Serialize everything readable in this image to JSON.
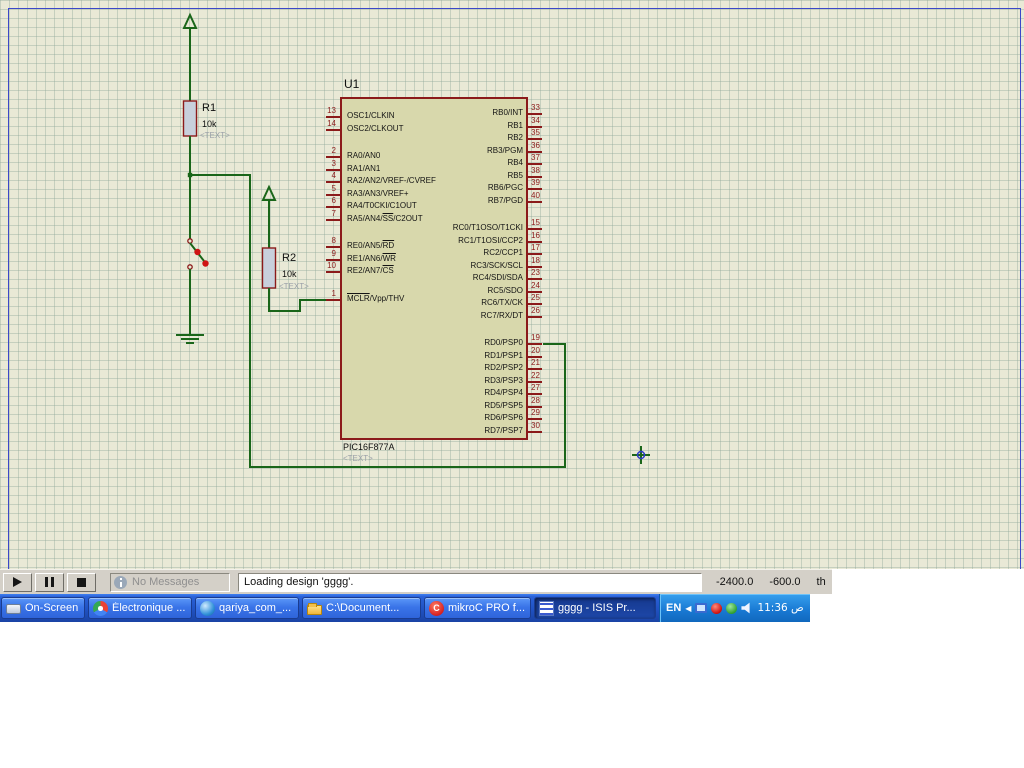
{
  "schematic": {
    "sheet": {
      "background": "#e9e9d6",
      "grid_color": "#cdd5bd",
      "border_color": "#3b48c9"
    },
    "wire_color": "#1a661a",
    "switch_dot_color": "#cf1414",
    "components": {
      "r1": {
        "ref": "R1",
        "value": "10k",
        "text": "<TEXT>"
      },
      "r2": {
        "ref": "R2",
        "value": "10k",
        "text": "<TEXT>"
      },
      "u1": {
        "ref": "U1",
        "device": "PIC16F877A",
        "text": "<TEXT>",
        "body_fill": "#d8d8ac",
        "outline": "#8b1a1a",
        "left_pins": [
          {
            "num": "13",
            "parts": [
              {
                "t": "OSC1/CLKIN",
                "o": false
              }
            ]
          },
          {
            "num": "14",
            "parts": [
              {
                "t": "OSC2/CLKOUT",
                "o": false
              }
            ]
          },
          {
            "num": "2",
            "gap": true,
            "parts": [
              {
                "t": "RA0/AN0",
                "o": false
              }
            ]
          },
          {
            "num": "3",
            "parts": [
              {
                "t": "RA1/AN1",
                "o": false
              }
            ]
          },
          {
            "num": "4",
            "parts": [
              {
                "t": "RA2/AN2/VREF-/CVREF",
                "o": false
              }
            ]
          },
          {
            "num": "5",
            "parts": [
              {
                "t": "RA3/AN3/VREF+",
                "o": false
              }
            ]
          },
          {
            "num": "6",
            "parts": [
              {
                "t": "RA4/T0CKI/C1OUT",
                "o": false
              }
            ]
          },
          {
            "num": "7",
            "parts": [
              {
                "t": "RA5/AN4/",
                "o": false
              },
              {
                "t": "SS",
                "o": true
              },
              {
                "t": "/C2OUT",
                "o": false
              }
            ]
          },
          {
            "num": "8",
            "gap": true,
            "parts": [
              {
                "t": "RE0/AN5/",
                "o": false
              },
              {
                "t": "RD",
                "o": true
              }
            ]
          },
          {
            "num": "9",
            "parts": [
              {
                "t": "RE1/AN6/",
                "o": false
              },
              {
                "t": "WR",
                "o": true
              }
            ]
          },
          {
            "num": "10",
            "parts": [
              {
                "t": "RE2/AN7/",
                "o": false
              },
              {
                "t": "CS",
                "o": true
              }
            ]
          },
          {
            "num": "1",
            "gap": true,
            "parts": [
              {
                "t": "MCLR",
                "o": true
              },
              {
                "t": "/Vpp/THV",
                "o": false
              }
            ]
          }
        ],
        "right_pins": [
          {
            "num": "33",
            "parts": [
              {
                "t": "RB0/INT",
                "o": false
              }
            ]
          },
          {
            "num": "34",
            "parts": [
              {
                "t": "RB1",
                "o": false
              }
            ]
          },
          {
            "num": "35",
            "parts": [
              {
                "t": "RB2",
                "o": false
              }
            ]
          },
          {
            "num": "36",
            "parts": [
              {
                "t": "RB3/PGM",
                "o": false
              }
            ]
          },
          {
            "num": "37",
            "parts": [
              {
                "t": "RB4",
                "o": false
              }
            ]
          },
          {
            "num": "38",
            "parts": [
              {
                "t": "RB5",
                "o": false
              }
            ]
          },
          {
            "num": "39",
            "parts": [
              {
                "t": "RB6/PGC",
                "o": false
              }
            ]
          },
          {
            "num": "40",
            "parts": [
              {
                "t": "RB7/PGD",
                "o": false
              }
            ]
          },
          {
            "num": "15",
            "gap": true,
            "parts": [
              {
                "t": "RC0/T1OSO/T1CKI",
                "o": false
              }
            ]
          },
          {
            "num": "16",
            "parts": [
              {
                "t": "RC1/T1OSI/CCP2",
                "o": false
              }
            ]
          },
          {
            "num": "17",
            "parts": [
              {
                "t": "RC2/CCP1",
                "o": false
              }
            ]
          },
          {
            "num": "18",
            "parts": [
              {
                "t": "RC3/SCK/SCL",
                "o": false
              }
            ]
          },
          {
            "num": "23",
            "parts": [
              {
                "t": "RC4/SDI/SDA",
                "o": false
              }
            ]
          },
          {
            "num": "24",
            "parts": [
              {
                "t": "RC5/SDO",
                "o": false
              }
            ]
          },
          {
            "num": "25",
            "parts": [
              {
                "t": "RC6/TX/CK",
                "o": false
              }
            ]
          },
          {
            "num": "26",
            "parts": [
              {
                "t": "RC7/RX/DT",
                "o": false
              }
            ]
          },
          {
            "num": "19",
            "gap": true,
            "parts": [
              {
                "t": "RD0/PSP0",
                "o": false
              }
            ]
          },
          {
            "num": "20",
            "parts": [
              {
                "t": "RD1/PSP1",
                "o": false
              }
            ]
          },
          {
            "num": "21",
            "parts": [
              {
                "t": "RD2/PSP2",
                "o": false
              }
            ]
          },
          {
            "num": "22",
            "parts": [
              {
                "t": "RD3/PSP3",
                "o": false
              }
            ]
          },
          {
            "num": "27",
            "parts": [
              {
                "t": "RD4/PSP4",
                "o": false
              }
            ]
          },
          {
            "num": "28",
            "parts": [
              {
                "t": "RD5/PSP5",
                "o": false
              }
            ]
          },
          {
            "num": "29",
            "parts": [
              {
                "t": "RD6/PSP6",
                "o": false
              }
            ]
          },
          {
            "num": "30",
            "parts": [
              {
                "t": "RD7/PSP7",
                "o": false
              }
            ]
          }
        ]
      }
    }
  },
  "statusbar": {
    "controls": [
      {
        "name": "play"
      },
      {
        "name": "pause"
      },
      {
        "name": "stop"
      }
    ],
    "no_messages": "No Messages",
    "message": "Loading design 'gggg'.",
    "coord": {
      "x": "-2400.0",
      "y": "-600.0",
      "units": "th"
    }
  },
  "taskbar": {
    "buttons": [
      {
        "label": "On-Screen K...",
        "icon": "keyboard-icon"
      },
      {
        "label": "Électronique ...",
        "icon": "browser-icon"
      },
      {
        "label": "qariya_com_...",
        "icon": "webpage-icon"
      },
      {
        "label": "C:\\Document...",
        "icon": "folder-icon"
      },
      {
        "label": "mikroC PRO f...",
        "icon": "mikroc-icon",
        "icon_letter": "C"
      },
      {
        "label": "gggg - ISIS Pr...",
        "icon": "isis-icon",
        "active": true
      }
    ],
    "tray": {
      "language": "EN",
      "chevron": "◀",
      "time": "11:36 ص"
    }
  }
}
